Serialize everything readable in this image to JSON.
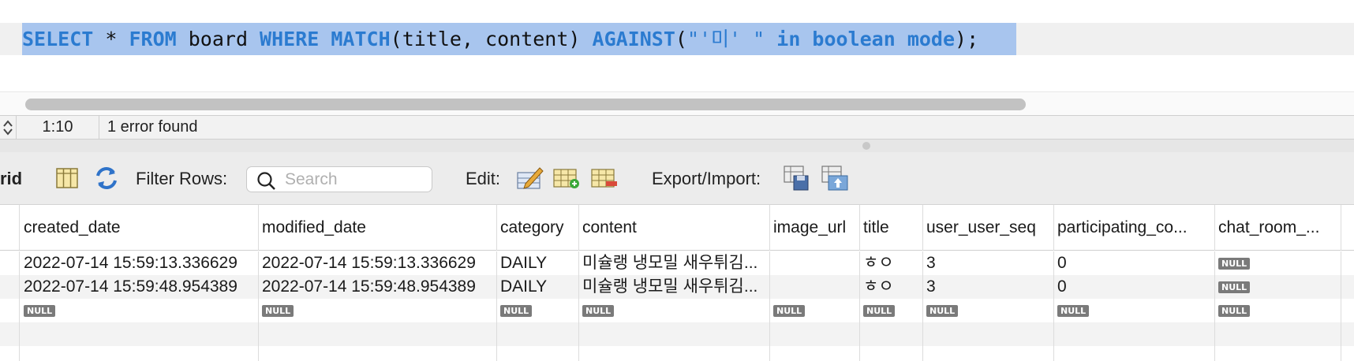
{
  "editor": {
    "sql_tokens": [
      {
        "text": "SELECT",
        "kind": "kw"
      },
      {
        "text": " * ",
        "kind": "plain"
      },
      {
        "text": "FROM",
        "kind": "kw"
      },
      {
        "text": " board ",
        "kind": "plain"
      },
      {
        "text": "WHERE",
        "kind": "kw"
      },
      {
        "text": " ",
        "kind": "plain"
      },
      {
        "text": "MATCH",
        "kind": "kw"
      },
      {
        "text": "(title, content) ",
        "kind": "plain"
      },
      {
        "text": "AGAINST",
        "kind": "kw"
      },
      {
        "text": "(",
        "kind": "plain"
      },
      {
        "text": "\"'미' \"",
        "kind": "str"
      },
      {
        "text": " ",
        "kind": "plain"
      },
      {
        "text": "in boolean mode",
        "kind": "kw"
      },
      {
        "text": ");",
        "kind": "plain"
      }
    ]
  },
  "status": {
    "cursor_position": "1:10",
    "message": "1 error found"
  },
  "toolbar": {
    "grid_label": "rid",
    "filter_label": "Filter Rows:",
    "search_placeholder": "Search",
    "edit_label": "Edit:",
    "export_label": "Export/Import:"
  },
  "grid": {
    "columns": [
      "created_date",
      "modified_date",
      "category",
      "content",
      "image_url",
      "title",
      "user_user_seq",
      "participating_co...",
      "chat_room_..."
    ],
    "rows": [
      [
        "2022-07-14 15:59:13.336629",
        "2022-07-14 15:59:13.336629",
        "DAILY",
        "미슐랭 냉모밀 새우튀김...",
        "",
        "ㅎㅇ",
        "3",
        "0",
        "NULL"
      ],
      [
        "2022-07-14 15:59:48.954389",
        "2022-07-14 15:59:48.954389",
        "DAILY",
        "미슐랭 냉모밀 새우튀김...",
        "",
        "ㅎㅇ",
        "3",
        "0",
        "NULL"
      ],
      [
        "NULL",
        "NULL",
        "NULL",
        "NULL",
        "NULL",
        "NULL",
        "NULL",
        "NULL",
        "NULL"
      ]
    ],
    "null_label": "NULL"
  },
  "colors": {
    "keyword": "#2b7bd0",
    "selection": "#a8c5ee",
    "null_badge": "#7a7a7a"
  }
}
